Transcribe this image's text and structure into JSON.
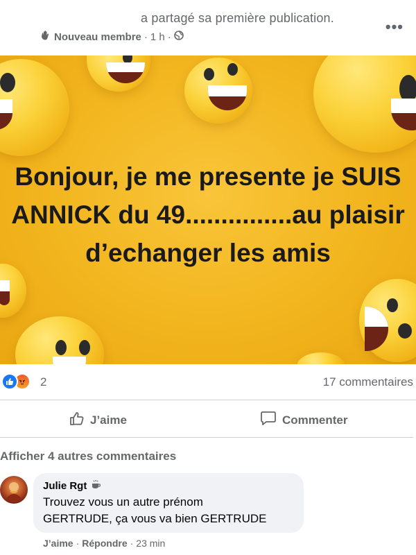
{
  "post": {
    "shared_text": "a partagé sa première publication.",
    "badge_label": "Nouveau membre",
    "time": "1 h",
    "more_label": "•••",
    "image_text": "Bonjour, je me presente je SUIS ANNICK du 49...............au plaisir d’echanger les amis"
  },
  "stats": {
    "reaction_count": "2",
    "comment_count": "17 commentaires"
  },
  "actions": {
    "like_label": "J’aime",
    "comment_label": "Commenter"
  },
  "comments": {
    "more_label": "Afficher 4 autres commentaires",
    "items": [
      {
        "author": "Julie Rgt",
        "text_line1": "Trouvez vous un autre prénom",
        "text_line2": "GERTRUDE, ça vous va bien GERTRUDE",
        "like_label": "J’aime",
        "reply_label": "Répondre",
        "time": "23 min"
      }
    ]
  },
  "colors": {
    "poster_bg": "#f2b51e",
    "like_blue": "#1877f2",
    "muted_text": "#65676b"
  },
  "icons": [
    "wave-hand-icon",
    "world-icon",
    "more-icon",
    "like-reaction-icon",
    "angry-reaction-icon",
    "thumbs-up-icon",
    "comment-icon",
    "coffee-icon"
  ]
}
